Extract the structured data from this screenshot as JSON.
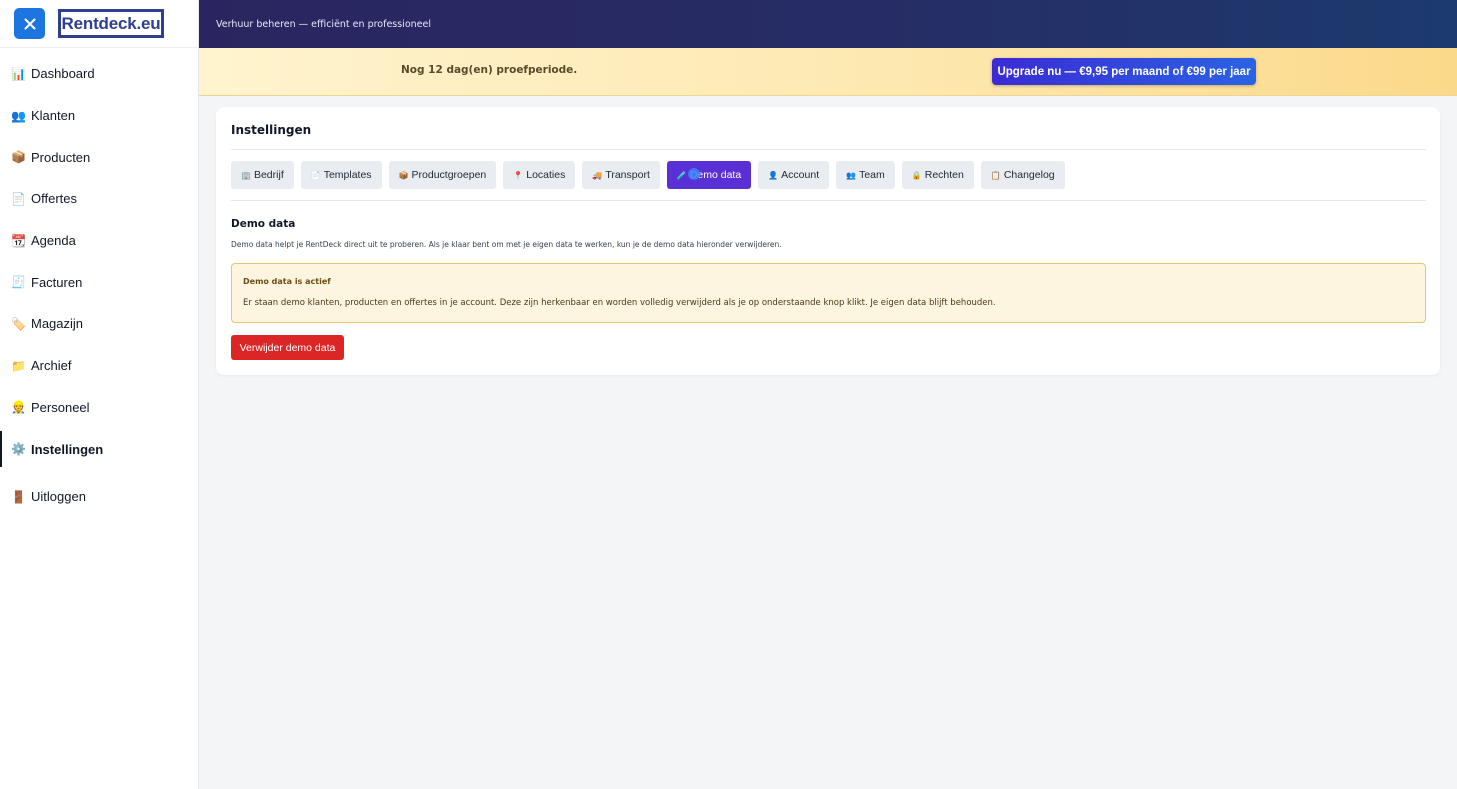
{
  "brand": {
    "logo_text": "Rentdeck.eu"
  },
  "sidebar": {
    "items": [
      {
        "icon": "📊",
        "label": "Dashboard"
      },
      {
        "icon": "👥",
        "label": "Klanten"
      },
      {
        "icon": "📦",
        "label": "Producten"
      },
      {
        "icon": "📄",
        "label": "Offertes"
      },
      {
        "icon": "📆",
        "label": "Agenda"
      },
      {
        "icon": "🧾",
        "label": "Facturen"
      },
      {
        "icon": "🏷️",
        "label": "Magazijn"
      },
      {
        "icon": "📁",
        "label": "Archief"
      },
      {
        "icon": "👷",
        "label": "Personeel"
      },
      {
        "icon": "⚙️",
        "label": "Instellingen",
        "active": true
      }
    ],
    "logout": {
      "icon": "🚪",
      "label": "Uitloggen"
    }
  },
  "header": {
    "tagline": "Verhuur beheren — efficiënt en professioneel"
  },
  "trial": {
    "text": "Nog 12 dag(en) proefperiode.",
    "upgrade_label": "Upgrade nu — €9,95 per maand of €99 per jaar"
  },
  "settings": {
    "title": "Instellingen",
    "tabs": [
      {
        "icon": "🏢",
        "label": "Bedrijf"
      },
      {
        "icon": "📄",
        "label": "Templates"
      },
      {
        "icon": "📦",
        "label": "Productgroepen"
      },
      {
        "icon": "📍",
        "label": "Locaties"
      },
      {
        "icon": "🚚",
        "label": "Transport"
      },
      {
        "icon": "🧪",
        "label": "Demo data",
        "active": true
      },
      {
        "icon": "👤",
        "label": "Account"
      },
      {
        "icon": "👥",
        "label": "Team"
      },
      {
        "icon": "🔒",
        "label": "Rechten"
      },
      {
        "icon": "📋",
        "label": "Changelog"
      }
    ],
    "section": {
      "title": "Demo data",
      "description": "Demo data helpt je RentDeck direct uit te proberen. Als je klaar bent om met je eigen data te werken, kun je de demo data hieronder verwijderen.",
      "notice_title": "Demo data is actief",
      "notice_text": "Er staan demo klanten, producten en offertes in je account. Deze zijn herkenbaar en worden volledig verwijderd als je op onderstaande knop klikt. Je eigen data blijft behouden.",
      "delete_label": "Verwijder demo data"
    }
  },
  "colors": {
    "accent": "#5b2fd6",
    "primary": "#1d75e0",
    "danger": "#dc2626",
    "header_bg": "#2a2560",
    "trial_bg": "#fde8b0",
    "notice_border": "#e7c66b"
  }
}
